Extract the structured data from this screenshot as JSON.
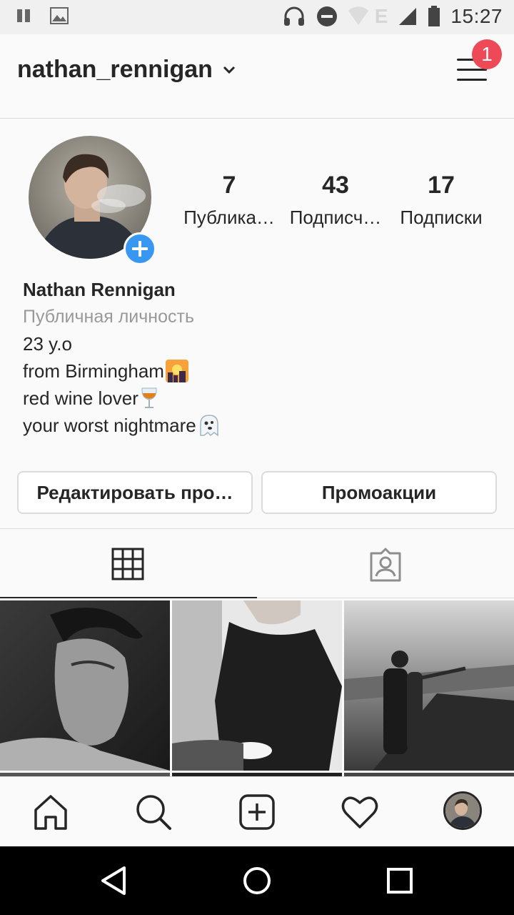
{
  "status_bar": {
    "time": "15:27",
    "network": "E"
  },
  "header": {
    "username": "nathan_rennigan",
    "notification_count": "1"
  },
  "profile": {
    "stats": [
      {
        "value": "7",
        "label": "Публика…"
      },
      {
        "value": "43",
        "label": "Подписч…"
      },
      {
        "value": "17",
        "label": "Подписки"
      }
    ],
    "name": "Nathan Rennigan",
    "category": "Публичная личность",
    "bio_lines": [
      "23 y.o",
      "from Birmingham",
      "red wine lover",
      "your worst nightmare"
    ],
    "bio_emojis": [
      "",
      "🌇",
      "🍷",
      "👻"
    ]
  },
  "actions": {
    "edit_profile": "Редактировать про…",
    "promotions": "Промоакции"
  },
  "tabs": [
    {
      "icon": "grid-icon",
      "active": true
    },
    {
      "icon": "tagged-icon",
      "active": false
    }
  ],
  "bottom_nav": [
    "home-icon",
    "search-icon",
    "add-post-icon",
    "heart-icon",
    "profile-avatar"
  ],
  "colors": {
    "accent": "#3897f0",
    "badge": "#ed4956",
    "text": "#262626",
    "muted": "#999999"
  }
}
